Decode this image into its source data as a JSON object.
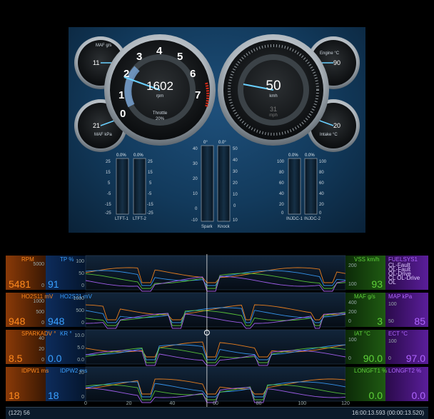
{
  "gauges": {
    "rpm": {
      "value": "1602",
      "unit": "rpm",
      "throttle_label": "Throttle",
      "throttle_value": "20%",
      "ticks": [
        "0",
        "1",
        "2",
        "3",
        "4",
        "5",
        "6",
        "7"
      ]
    },
    "speed": {
      "value": "50",
      "unit": "kmh",
      "sub_value": "31",
      "sub_unit": "mph"
    },
    "maf_gs": {
      "label": "MAF g/s",
      "value": "11"
    },
    "maf_kpa": {
      "label": "MAF kPa",
      "value": "21"
    },
    "engine_c": {
      "label": "Engine °C",
      "value": "90"
    },
    "intake_c": {
      "label": "Intake °C",
      "value": "20"
    }
  },
  "bars": {
    "ltft1": {
      "label": "LTFT-1",
      "pct": "0.0%"
    },
    "ltft2": {
      "label": "LTFT-2",
      "pct": "0.0%"
    },
    "spark": {
      "label": "Spark",
      "pct": "0°"
    },
    "knock": {
      "label": "Knock",
      "pct": "0.0°"
    },
    "injdc1": {
      "label": "INJDC-1",
      "pct": "0.0%"
    },
    "injdc2": {
      "label": "INJDC-2",
      "pct": "0.0%"
    },
    "trim_scale": [
      "25",
      "15",
      "5",
      "-5",
      "-15",
      "-25"
    ],
    "spark_scale": [
      "40",
      "30",
      "20",
      "10",
      "0",
      "-10"
    ],
    "knock_scale": [
      "50",
      "40",
      "30",
      "20",
      "10",
      "0",
      "10"
    ],
    "injdc_scale": [
      "100",
      "80",
      "60",
      "40",
      "20",
      "0"
    ]
  },
  "logger": {
    "rows": [
      {
        "left_label": "RPM",
        "left_value": "5481",
        "left_color": "#ff8a1e",
        "left_scale": [
          "5000",
          "0"
        ],
        "left2_label": "TP %",
        "left2_value": "91",
        "left2_color": "#3aa0ff",
        "left2_scale": [
          "100",
          "50",
          "0"
        ],
        "right_label": "VSS km/h",
        "right_value": "93",
        "right_color": "#5fd23a",
        "right_scale": [
          "200",
          "100"
        ],
        "right2_label": "FUELSYS1",
        "right2_color": "#b066ff",
        "right2_list": [
          "CL-Fault",
          "OL-Fault",
          "OL-Drive",
          "CL    OL-Drive",
          "OL"
        ]
      },
      {
        "left_label": "HO2S11 mV",
        "left_value": "948",
        "left_color": "#ff8a1e",
        "left_scale": [
          "1000",
          "500",
          "0"
        ],
        "left2_label": "HO2S21 mV",
        "left2_value": "948",
        "left2_color": "#3aa0ff",
        "left2_scale": [
          "1000",
          "500",
          "0"
        ],
        "right_label": "MAF g/s",
        "right_value": "3",
        "right_color": "#5fd23a",
        "right_scale": [
          "400",
          "200",
          "0"
        ],
        "right2_label": "MAP kPa",
        "right2_value": "85",
        "right2_color": "#b066ff",
        "right2_scale": [
          "100",
          "50"
        ]
      },
      {
        "left_label": "SPARKADV °",
        "left_value": "8.5",
        "left_color": "#ff8a1e",
        "left_scale": [
          "40",
          "20",
          "0"
        ],
        "left2_label": "KR °",
        "left2_value": "0.0",
        "left2_color": "#3aa0ff",
        "left2_scale": [
          "10.0",
          "5.0",
          "0.0"
        ],
        "right_label": "IAT °C",
        "right_value": "90.0",
        "right_color": "#5fd23a",
        "right_scale": [
          "100",
          "0"
        ],
        "right2_label": "ECT °C",
        "right2_value": "97.0",
        "right2_color": "#b066ff",
        "right2_scale": [
          "100",
          "0"
        ]
      },
      {
        "left_label": "IDPW1 ms",
        "left_value": "18",
        "left_color": "#ff8a1e",
        "left_scale": [],
        "left2_label": "IDPW2 ms",
        "left2_value": "18",
        "left2_color": "#3aa0ff",
        "left2_scale": [
          "20",
          "0"
        ],
        "right_label": "LONGFT1 %",
        "right_value": "0.0",
        "right_color": "#5fd23a",
        "right_scale": [],
        "right2_label": "LONGFT2 %",
        "right2_value": "0.0",
        "right2_color": "#b066ff",
        "right2_scale": []
      }
    ],
    "x_ticks": [
      "0",
      "20",
      "40",
      "60",
      "80",
      "100",
      "120"
    ],
    "status_left": "(122) 56",
    "status_right": "16:00:13.593 (00:00:13.520)"
  }
}
